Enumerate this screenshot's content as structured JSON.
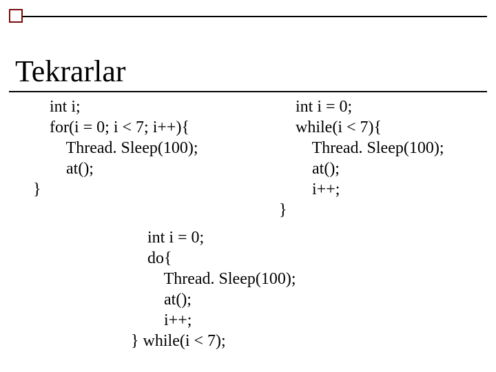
{
  "slide": {
    "title": "Tekrarlar",
    "code_for": "    int i;\n    for(i = 0; i < 7; i++){\n        Thread. Sleep(100);\n        at();\n}",
    "code_while": "    int i = 0;\n    while(i < 7){\n        Thread. Sleep(100);\n        at();\n        i++;\n}",
    "code_do": "    int i = 0;\n    do{\n        Thread. Sleep(100);\n        at();\n        i++;\n} while(i < 7);"
  }
}
